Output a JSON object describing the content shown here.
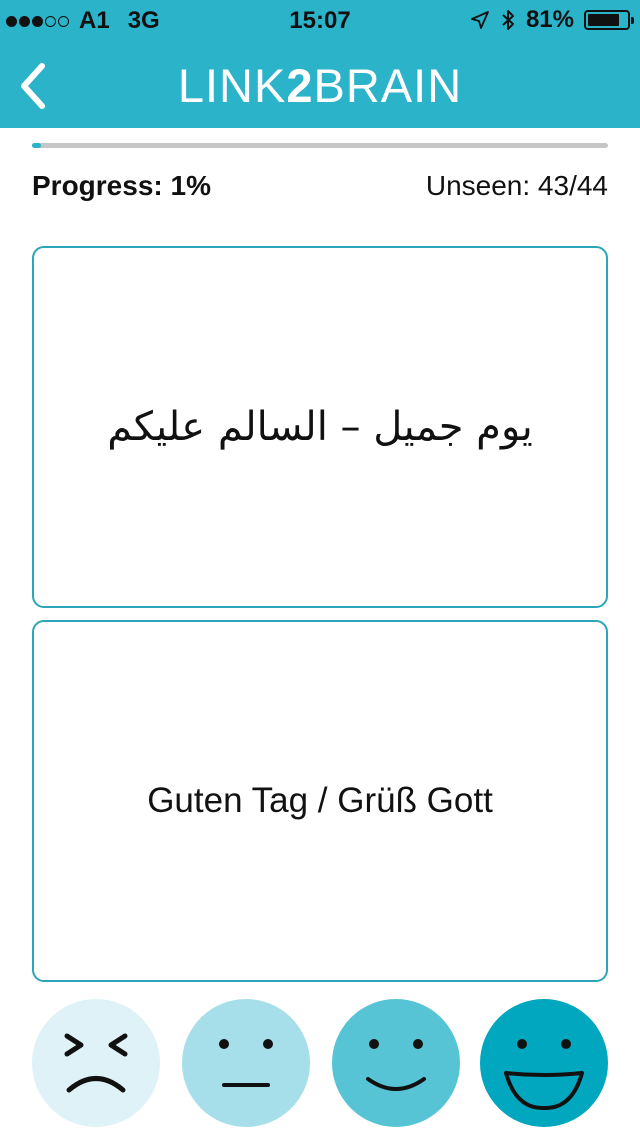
{
  "status_bar": {
    "carrier": "A1",
    "network": "3G",
    "time": "15:07",
    "battery": "81%",
    "battery_level": 0.81,
    "signal_bars_filled": 3,
    "signal_bars_total": 5
  },
  "header": {
    "brand_left": "LINK",
    "brand_two": "2",
    "brand_right": "BRAIN",
    "back_icon": "chevron-left-icon"
  },
  "progress": {
    "label": "Progress: 1%",
    "value": 0.01,
    "unseen_label": "Unseen: 43/44"
  },
  "cards": {
    "front_text": "يوم جميل – السالم عليكم",
    "back_text": "Guten Tag / Grüß Gott"
  },
  "ratings": {
    "colors": [
      "#dff2f7",
      "#a6dfea",
      "#57c4d6",
      "#00a7bf"
    ],
    "icons": [
      "frustrated-face-icon",
      "neutral-face-icon",
      "smiling-face-icon",
      "grinning-face-icon"
    ]
  },
  "colors": {
    "accent": "#2bb3c9",
    "card_border": "#2aa6b8"
  }
}
